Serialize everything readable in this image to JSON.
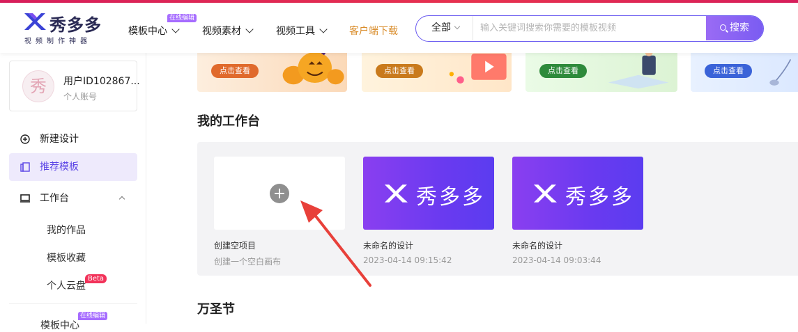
{
  "brand": {
    "title": "秀多多",
    "subtitle": "视频制作神器"
  },
  "nav": {
    "items": [
      {
        "label": "模板中心",
        "badge": "在线编辑"
      },
      {
        "label": "视频素材"
      },
      {
        "label": "视频工具"
      }
    ],
    "download": "客户端下载"
  },
  "search": {
    "scope": "全部",
    "placeholder": "输入关键词搜索你需要的模板视频",
    "button": "搜索"
  },
  "user": {
    "avatar_char": "秀",
    "name": "用户ID102867...",
    "type": "个人账号"
  },
  "sidebar": {
    "new_design": "新建设计",
    "recommend": "推荐模板",
    "workbench": "工作台",
    "my_works": "我的作品",
    "favorites": "模板收藏",
    "cloud": "个人云盘",
    "cloud_badge": "Beta",
    "template_center": "模板中心",
    "template_center_badge": "在线编辑"
  },
  "banners": [
    {
      "button": "点击查看",
      "color": "#e06a2c"
    },
    {
      "button": "点击查看",
      "color": "#c97a1c"
    },
    {
      "button": "点击查看",
      "color": "#2e8a3b"
    },
    {
      "button": "点击查看",
      "color": "#3a63d8"
    }
  ],
  "workbench": {
    "title": "我的工作台",
    "cards": [
      {
        "title": "创建空项目",
        "subtitle": "创建一个空白画布"
      },
      {
        "title": "未命名的设计",
        "subtitle": "2023-04-14 09:15:42",
        "logo": "秀多多"
      },
      {
        "title": "未命名的设计",
        "subtitle": "2023-04-14 09:03:44",
        "logo": "秀多多"
      }
    ]
  },
  "next_section": {
    "title": "万圣节"
  },
  "colors": {
    "accent": "#6b5cf0",
    "active_bg": "#eeeafc",
    "arrow": "#e8403a"
  }
}
